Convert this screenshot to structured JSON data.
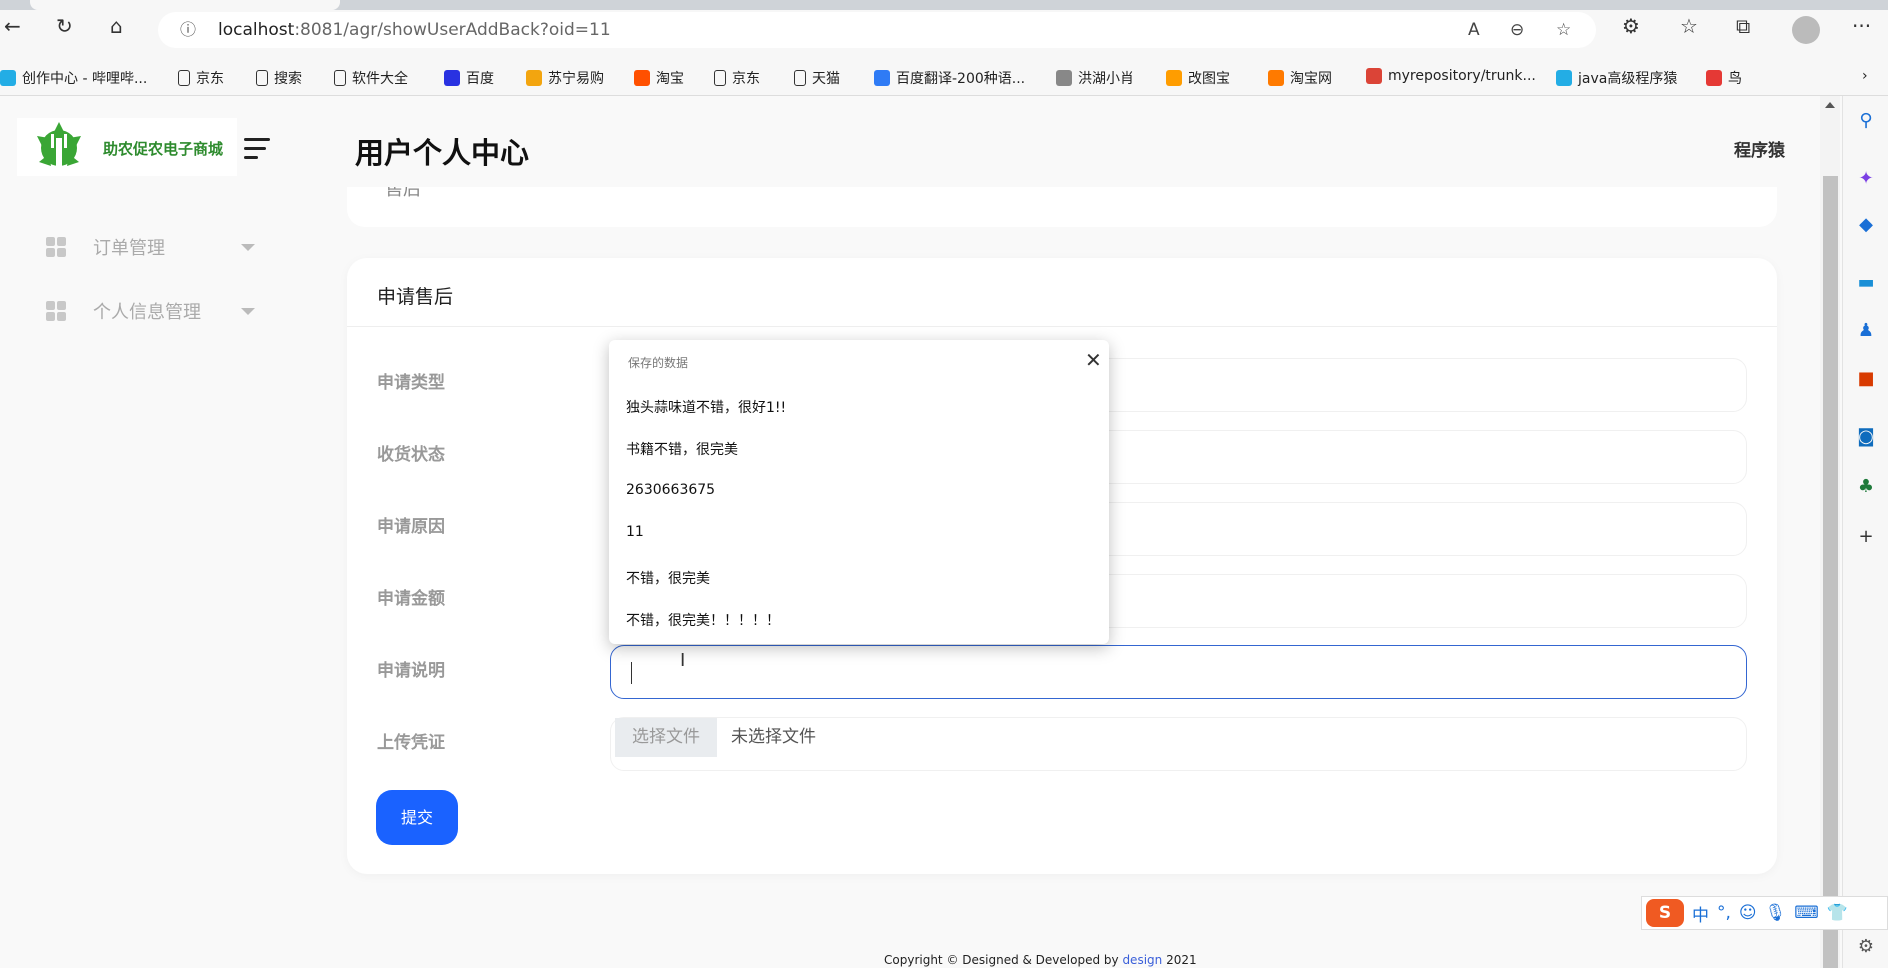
{
  "browser": {
    "url_host": "localhost",
    "url_path": ":8081/agr/showUserAddBack?oid=11",
    "bookmarks": [
      {
        "label": "创作中心 - 哔哩哔...",
        "icon": "bilibili-icon",
        "color": "#23ade5"
      },
      {
        "label": "京东",
        "icon": "page-icon",
        "color": ""
      },
      {
        "label": "搜索",
        "icon": "page-icon",
        "color": ""
      },
      {
        "label": "软件大全",
        "icon": "page-icon",
        "color": ""
      },
      {
        "label": "百度",
        "icon": "baidu-icon",
        "color": "#2932e1"
      },
      {
        "label": "苏宁易购",
        "icon": "suning-icon",
        "color": "#f3a50f"
      },
      {
        "label": "淘宝",
        "icon": "taobao-icon",
        "color": "#ff5000"
      },
      {
        "label": "京东",
        "icon": "page-icon",
        "color": ""
      },
      {
        "label": "天猫",
        "icon": "page-icon",
        "color": ""
      },
      {
        "label": "百度翻译-200种语...",
        "icon": "translate-icon",
        "color": "#2f7bf5"
      },
      {
        "label": "洪湖小肖",
        "icon": "bird-icon",
        "color": "#888888"
      },
      {
        "label": "改图宝",
        "icon": "gaitubao-icon",
        "color": "#ff9d00"
      },
      {
        "label": "淘宝网",
        "icon": "taobao-icon",
        "color": "#ff7a00"
      },
      {
        "label": "myrepository/trunk...",
        "icon": "chrome-icon",
        "color": "#db4437"
      },
      {
        "label": "java高级程序猿",
        "icon": "bilibili-icon",
        "color": "#23ade5"
      },
      {
        "label": "鸟",
        "icon": "bird-icon",
        "color": "#e53935"
      }
    ]
  },
  "app": {
    "logo_text": "助农促农电子商城",
    "page_title": "用户个人中心",
    "username": "程序猿",
    "sidebar": [
      {
        "label": "订单管理"
      },
      {
        "label": "个人信息管理"
      }
    ],
    "top_card_text": "售后"
  },
  "form": {
    "title": "申请售后",
    "fields": [
      {
        "label": "申请类型",
        "value": ""
      },
      {
        "label": "收货状态",
        "value": ""
      },
      {
        "label": "申请原因",
        "value": ""
      },
      {
        "label": "申请金额",
        "value": ""
      },
      {
        "label": "申请说明",
        "value": ""
      }
    ],
    "upload_label": "上传凭证",
    "file_button": "选择文件",
    "file_status": "未选择文件",
    "submit": "提交"
  },
  "autofill": {
    "title": "保存的数据",
    "items": [
      "独头蒜味道不错，很好1!!",
      "书籍不错，很完美",
      "2630663675",
      "11",
      "不错，很完美",
      "不错，很完美！！！！！"
    ]
  },
  "footer": {
    "prefix": "Copyright © Designed & Developed by ",
    "link": "design",
    "suffix": " 2021"
  },
  "ime": {
    "mode": "中",
    "punct": "°,"
  },
  "colors": {
    "accent": "#1a62ff",
    "focus": "#3466d1",
    "logo_green": "#2e8b2e"
  }
}
